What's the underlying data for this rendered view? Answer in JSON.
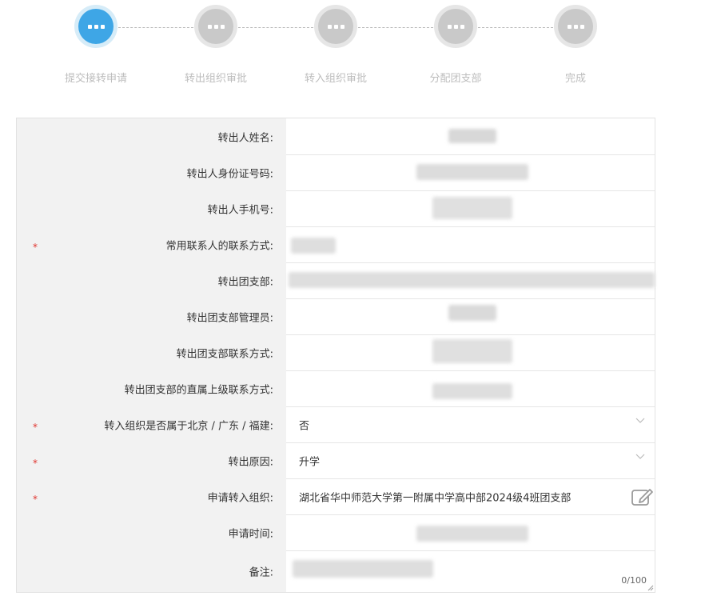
{
  "steps": [
    {
      "label": "提交接转申请",
      "active": true
    },
    {
      "label": "转出组织审批",
      "active": false
    },
    {
      "label": "转入组织审批",
      "active": false
    },
    {
      "label": "分配团支部",
      "active": false
    },
    {
      "label": "完成",
      "active": false
    }
  ],
  "form": {
    "rows": [
      {
        "label": "转出人姓名:",
        "required": false
      },
      {
        "label": "转出人身份证号码:",
        "required": false
      },
      {
        "label": "转出人手机号:",
        "required": false
      },
      {
        "label": "常用联系人的联系方式:",
        "required": true
      },
      {
        "label": "转出团支部:",
        "required": false
      },
      {
        "label": "转出团支部管理员:",
        "required": false
      },
      {
        "label": "转出团支部联系方式:",
        "required": false
      },
      {
        "label": "转出团支部的直属上级联系方式:",
        "required": false
      },
      {
        "label": "转入组织是否属于北京 / 广东 / 福建:",
        "required": true,
        "value": "否",
        "type": "select"
      },
      {
        "label": "转出原因:",
        "required": true,
        "value": "升学",
        "type": "select"
      },
      {
        "label": "申请转入组织:",
        "required": true,
        "value": "湖北省华中师范大学第一附属中学高中部2024级4班团支部",
        "type": "picker"
      },
      {
        "label": "申请时间:",
        "required": false
      },
      {
        "label": "备注:",
        "required": false,
        "type": "textarea",
        "counter": "0/100"
      }
    ]
  },
  "colors": {
    "active_step": "#3ea6e6",
    "inactive_step": "#c9c9c9",
    "required_mark": "#e0342f",
    "label_bg": "#f2f2f2"
  },
  "icons": {
    "step": "dots-icon",
    "select": "chevron-down-icon",
    "picker": "edit-icon",
    "textarea": "resize-handle-icon"
  }
}
